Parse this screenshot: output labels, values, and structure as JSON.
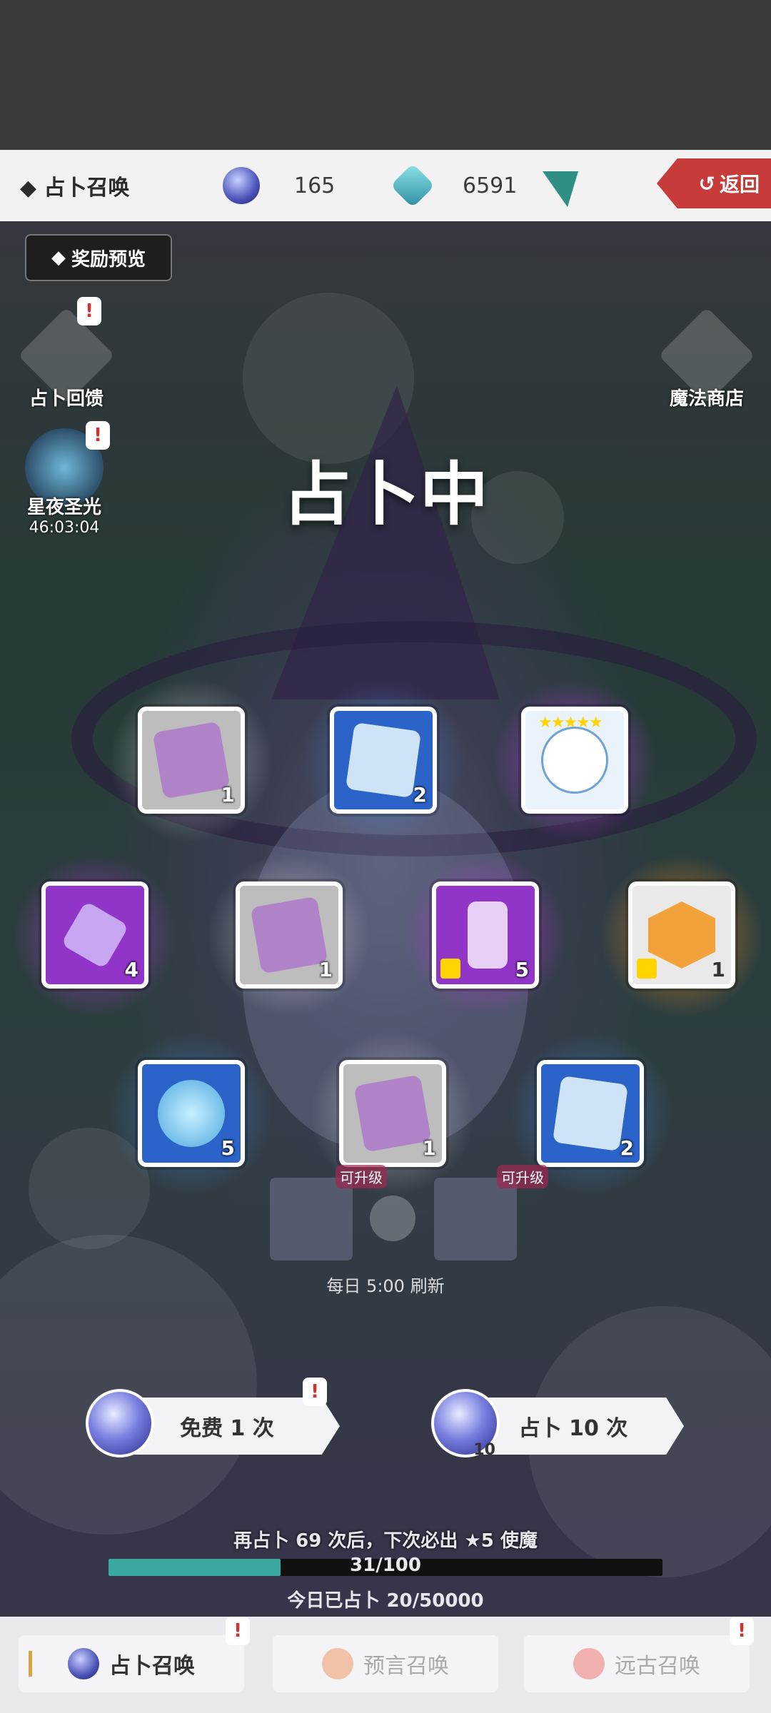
{
  "header": {
    "title": "◆ 占卜召唤",
    "crystal_ball_count": "165",
    "gem_count": "6591",
    "back_label": "返回"
  },
  "scene": {
    "reward_preview_label": "奖励预览",
    "left_buttons": [
      {
        "label": "占卜回馈"
      },
      {
        "label": "星夜圣光",
        "timer": "46:03:04"
      }
    ],
    "right_buttons": [
      {
        "label": "魔法商店"
      }
    ],
    "status_text": "占卜中",
    "rewards": [
      {
        "rarity": "grey",
        "item": "tarot-card",
        "count": "1"
      },
      {
        "rarity": "blue",
        "item": "blue-scroll",
        "count": "2"
      },
      {
        "rarity": "purple",
        "item": "bunny-character",
        "stars": "★★★★★",
        "count": ""
      },
      {
        "rarity": "purple",
        "item": "purple-crystal",
        "count": "4"
      },
      {
        "rarity": "grey",
        "item": "tarot-card",
        "count": "1"
      },
      {
        "rarity": "purple",
        "item": "purple-shard",
        "count": "5"
      },
      {
        "rarity": "orange",
        "item": "hero-shard",
        "count": "1"
      },
      {
        "rarity": "blue",
        "item": "blue-flame",
        "count": "5"
      },
      {
        "rarity": "grey",
        "item": "tarot-card",
        "count": "1"
      },
      {
        "rarity": "blue",
        "item": "blue-scroll",
        "count": "2"
      }
    ],
    "upgradable_label": "可升级",
    "refresh_text": "每日 5:00 刷新"
  },
  "summon": {
    "free_label": "免费 1 次",
    "ten_label": "占卜 10 次",
    "ten_orb_count": "10",
    "pity_text": "再占卜 69 次后，下次必出 ★5 使魔",
    "progress_text": "31/100",
    "progress_value": 0.31,
    "today_text": "今日已占卜 20/50000"
  },
  "bottom_nav": {
    "tabs": [
      {
        "label": "占卜召唤",
        "active": true
      },
      {
        "label": "预言召唤",
        "active": false
      },
      {
        "label": "远古召唤",
        "active": false
      }
    ]
  },
  "colors": {
    "grey_rarity": "#bdbdbd",
    "blue_rarity": "#2b63c9",
    "purple_rarity": "#9135c8",
    "orange_rarity": "#e08a2a",
    "progress_fill": "#3aa7a0",
    "back_button": "#c73b3b"
  }
}
